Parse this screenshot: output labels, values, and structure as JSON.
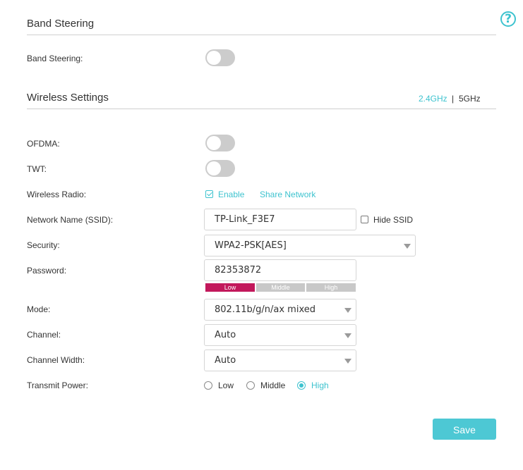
{
  "band_steering": {
    "section_title": "Band Steering",
    "label": "Band Steering:",
    "enabled": false
  },
  "wireless_settings": {
    "section_title": "Wireless Settings",
    "bands": [
      "2.4GHz",
      "5GHz"
    ],
    "band_separator": "|",
    "active_band": "2.4GHz",
    "ofdma": {
      "label": "OFDMA:",
      "enabled": false
    },
    "twt": {
      "label": "TWT:",
      "enabled": false
    },
    "wireless_radio": {
      "label": "Wireless Radio:",
      "enable_label": "Enable",
      "enabled": true,
      "share_network_label": "Share Network"
    },
    "ssid": {
      "label": "Network Name (SSID):",
      "value": "TP-Link_F3E7",
      "hide_label": "Hide SSID",
      "hidden": false
    },
    "security": {
      "label": "Security:",
      "value": "WPA2-PSK[AES]"
    },
    "password": {
      "label": "Password:",
      "value": "82353872",
      "strength_levels": [
        "Low",
        "Middle",
        "High"
      ],
      "strength": "Low"
    },
    "mode": {
      "label": "Mode:",
      "value": "802.11b/g/n/ax mixed"
    },
    "channel": {
      "label": "Channel:",
      "value": "Auto"
    },
    "channel_width": {
      "label": "Channel Width:",
      "value": "Auto"
    },
    "transmit_power": {
      "label": "Transmit Power:",
      "options": [
        "Low",
        "Middle",
        "High"
      ],
      "selected": "High"
    }
  },
  "save_label": "Save",
  "colors": {
    "accent": "#3ec3cf",
    "strength_low": "#c2185b",
    "strength_inactive": "#c8c8c8",
    "toggle_off": "#cccccc"
  },
  "icons": {
    "help": "question-circle-icon",
    "dropdown": "chevron-down-icon"
  }
}
